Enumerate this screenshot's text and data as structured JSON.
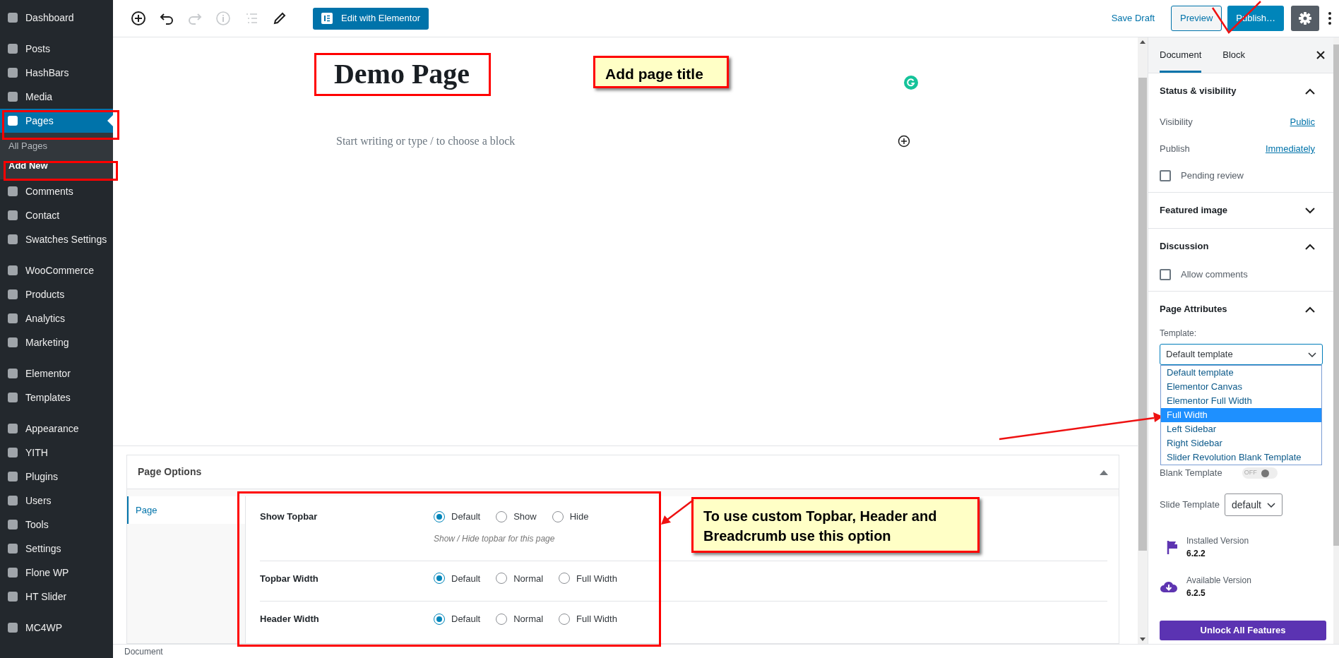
{
  "sidebar": {
    "groups": [
      [
        {
          "label": "Dashboard",
          "selected": false
        }
      ],
      [
        {
          "label": "Posts",
          "selected": false
        },
        {
          "label": "HashBars",
          "selected": false
        },
        {
          "label": "Media",
          "selected": false
        },
        {
          "label": "Pages",
          "selected": true,
          "children": [
            {
              "label": "All Pages",
              "selected": false
            },
            {
              "label": "Add New",
              "selected": true
            }
          ]
        },
        {
          "label": "Comments",
          "selected": false
        },
        {
          "label": "Contact",
          "selected": false
        },
        {
          "label": "Swatches Settings",
          "selected": false
        }
      ],
      [
        {
          "label": "WooCommerce",
          "selected": false
        },
        {
          "label": "Products",
          "selected": false
        },
        {
          "label": "Analytics",
          "selected": false
        },
        {
          "label": "Marketing",
          "selected": false
        }
      ],
      [
        {
          "label": "Elementor",
          "selected": false
        },
        {
          "label": "Templates",
          "selected": false
        }
      ],
      [
        {
          "label": "Appearance",
          "selected": false
        },
        {
          "label": "YITH",
          "selected": false
        },
        {
          "label": "Plugins",
          "selected": false
        },
        {
          "label": "Users",
          "selected": false
        },
        {
          "label": "Tools",
          "selected": false
        },
        {
          "label": "Settings",
          "selected": false
        },
        {
          "label": "Flone WP",
          "selected": false
        },
        {
          "label": "HT Slider",
          "selected": false
        }
      ],
      [
        {
          "label": "MC4WP",
          "selected": false
        }
      ]
    ]
  },
  "toolbar": {
    "icons": [
      {
        "kind": "add",
        "disabled": false
      },
      {
        "kind": "undo",
        "disabled": false
      },
      {
        "kind": "redo",
        "disabled": true
      },
      {
        "kind": "info",
        "disabled": true
      },
      {
        "kind": "outline",
        "disabled": true
      },
      {
        "kind": "edit",
        "disabled": false
      }
    ],
    "edit_button": "Edit with Elementor",
    "save_draft": "Save Draft",
    "preview": "Preview",
    "publish": "Publish…",
    "settings_pressed": true
  },
  "editor": {
    "title": "Demo Page",
    "placeholder": "Start writing or type / to choose a block"
  },
  "page_options": {
    "title": "Page Options",
    "tabs": [
      {
        "label": "Page",
        "selected": true
      }
    ],
    "fields": [
      {
        "label": "Show Topbar",
        "options": [
          {
            "label": "Default",
            "selected": true
          },
          {
            "label": "Show",
            "selected": false
          },
          {
            "label": "Hide",
            "selected": false
          }
        ],
        "hint": "Show / Hide topbar for this page"
      },
      {
        "label": "Topbar Width",
        "options": [
          {
            "label": "Default",
            "selected": true
          },
          {
            "label": "Normal",
            "selected": false
          },
          {
            "label": "Full Width",
            "selected": false
          }
        ]
      },
      {
        "label": "Header Width",
        "options": [
          {
            "label": "Default",
            "selected": true
          },
          {
            "label": "Normal",
            "selected": false
          },
          {
            "label": "Full Width",
            "selected": false
          }
        ]
      }
    ]
  },
  "settings_panel": {
    "tabs": [
      {
        "label": "Document",
        "selected": true
      },
      {
        "label": "Block",
        "selected": false
      }
    ],
    "status_visibility": {
      "title": "Status & visibility",
      "expanded": true,
      "rows": [
        {
          "label": "Visibility",
          "value": "Public"
        },
        {
          "label": "Publish",
          "value": "Immediately"
        }
      ],
      "pending_review": {
        "label": "Pending review",
        "checked": false
      }
    },
    "featured_image": {
      "title": "Featured image",
      "expanded": false
    },
    "discussion": {
      "title": "Discussion",
      "expanded": true,
      "allow_comments": {
        "label": "Allow comments",
        "checked": false
      }
    },
    "page_attributes": {
      "title": "Page Attributes",
      "expanded": true,
      "template_label": "Template:",
      "template_value": "Default template",
      "template_options": [
        {
          "label": "Default template",
          "selected": false
        },
        {
          "label": "Elementor Canvas",
          "selected": false
        },
        {
          "label": "Elementor Full Width",
          "selected": false
        },
        {
          "label": "Full Width",
          "selected": true
        },
        {
          "label": "Left Sidebar",
          "selected": false
        },
        {
          "label": "Right Sidebar",
          "selected": false
        },
        {
          "label": "Slider Revolution Blank Template",
          "selected": false
        }
      ]
    },
    "slider_revolution": {
      "blank_template": {
        "label": "Blank Template",
        "on": false,
        "state_text": "OFF"
      },
      "slide_template": {
        "label": "Slide Template",
        "value": "default"
      },
      "versions": [
        {
          "kind": "installed",
          "label": "Installed Version",
          "value": "6.2.2"
        },
        {
          "kind": "available",
          "label": "Available Version",
          "value": "6.2.5"
        }
      ],
      "unlock_button": "Unlock All Features"
    }
  },
  "status_bar": {
    "text": "Document"
  },
  "annotations": {
    "callouts": [
      {
        "text": "Add page title"
      },
      {
        "text": "To use custom Topbar, Header and Breadcrumb use this option"
      }
    ]
  }
}
